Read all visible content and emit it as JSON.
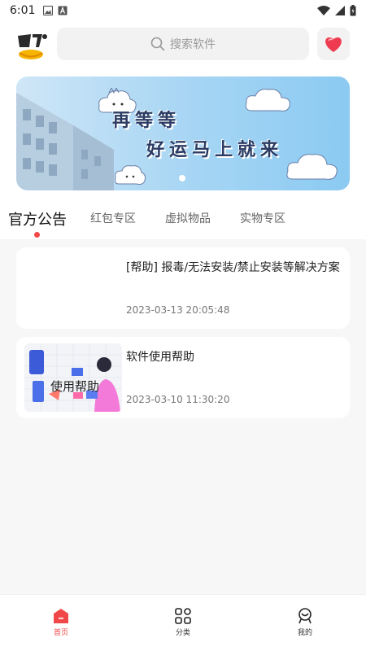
{
  "status_bar": {
    "time": "6:01"
  },
  "header": {
    "search": {
      "placeholder": "搜索软件",
      "icon": "search-icon"
    },
    "logo_icon": "app-logo",
    "fav_icon": "heart-icon"
  },
  "banner": {
    "line1": "再等等",
    "line2": "好运马上就来",
    "colors": {
      "bg_start": "#cfe6f6",
      "bg_end": "#8bcaf2",
      "text": "#2b3b63"
    }
  },
  "tabs": [
    {
      "label": "官方公告",
      "active": true
    },
    {
      "label": "红包专区",
      "active": false
    },
    {
      "label": "虚拟物品",
      "active": false
    },
    {
      "label": "实物专区",
      "active": false
    }
  ],
  "posts": [
    {
      "title": "[帮助] 报毒/无法安装/禁止安装等解决方案",
      "date": "2023-03-13 20:05:48"
    },
    {
      "title": "软件使用帮助",
      "date": "2023-03-10 11:30:20",
      "thumb_text": "使用帮助"
    }
  ],
  "bottom_nav": [
    {
      "label": "首页",
      "icon": "home-icon",
      "active": true
    },
    {
      "label": "分类",
      "icon": "grid-icon",
      "active": false
    },
    {
      "label": "我的",
      "icon": "profile-icon",
      "active": false
    }
  ],
  "colors": {
    "accent": "#f04848",
    "page_bg": "#f7f7f7"
  }
}
